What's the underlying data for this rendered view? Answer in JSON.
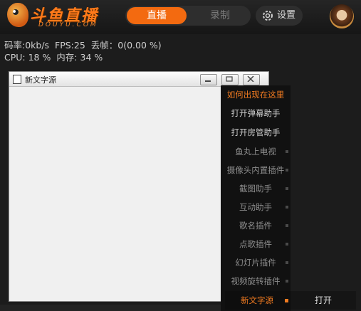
{
  "app": {
    "logo_text": "斗鱼直播",
    "logo_subtext": "DOUYU.COM"
  },
  "header": {
    "tab_live": "直播",
    "tab_record": "录制",
    "settings_label": "设置",
    "accent_color": "#f36a10"
  },
  "stats": {
    "line1": "码率:0kb/s  FPS:25  丢帧：0(0.00 %)",
    "line2": "CPU: 18 %  内存: 34 %"
  },
  "source_window": {
    "title": "新文字源"
  },
  "menu": {
    "header": "如何出现在这里",
    "items": [
      "打开弹幕助手",
      "打开房管助手",
      "鱼丸上电视",
      "摄像头内置插件",
      "截图助手",
      "互动助手",
      "歌名插件",
      "点歌插件",
      "幻灯片插件",
      "视频旋转插件"
    ],
    "selected": "新文字源",
    "action": "打开"
  }
}
